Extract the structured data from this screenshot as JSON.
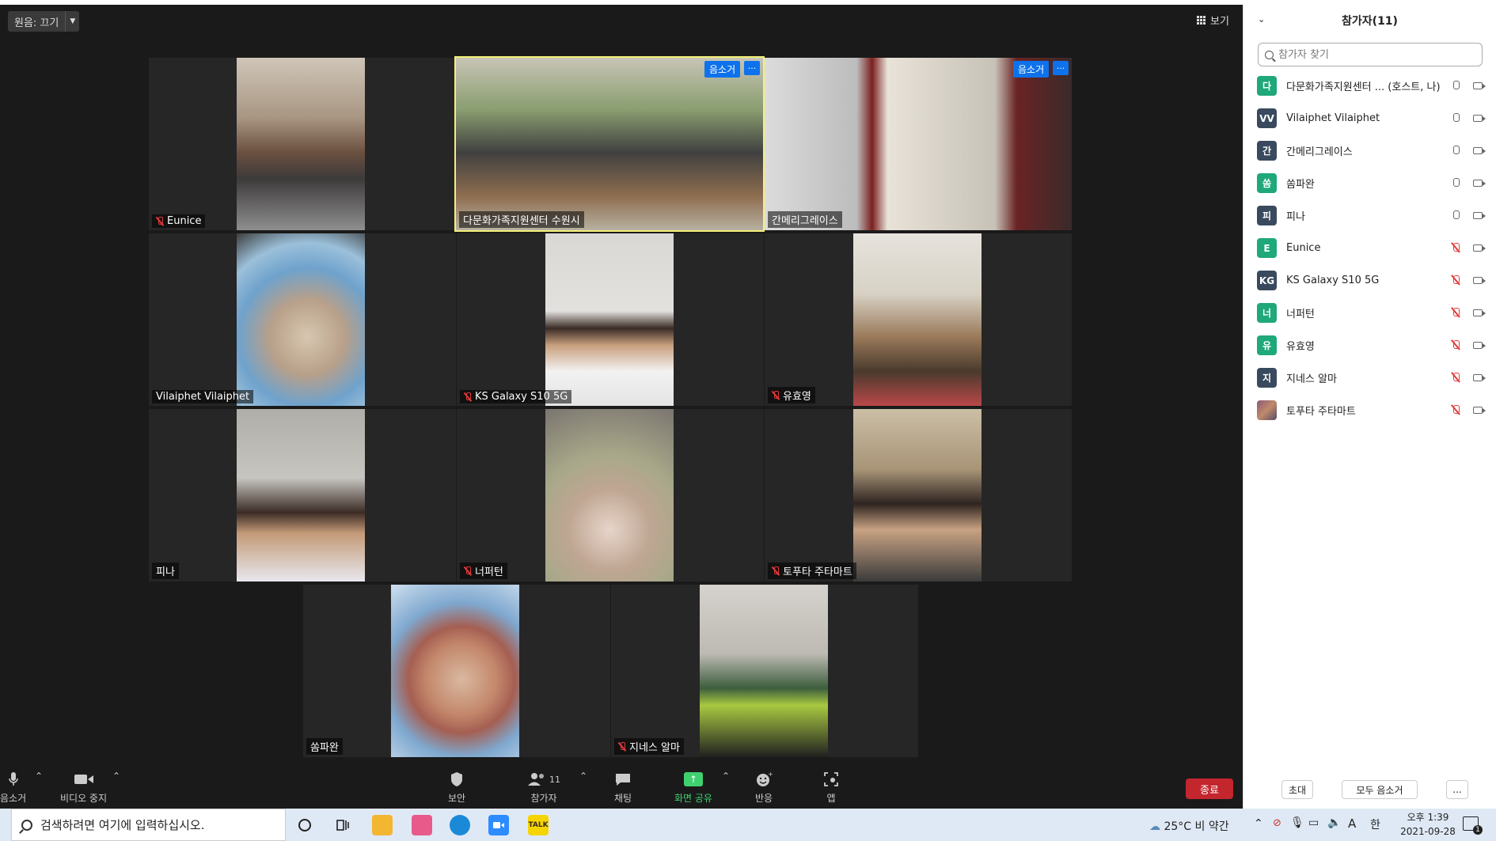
{
  "meeting": {
    "audio_label": "원음: 끄기",
    "view_label": "보기",
    "tiles": [
      {
        "name": "Eunice",
        "muted": true
      },
      {
        "name": "다문화가족지원센터 수원시",
        "muted": false,
        "active": true,
        "chip": "음소거",
        "more": "···"
      },
      {
        "name": "간메리그레이스",
        "muted": false,
        "chip": "음소거",
        "more": "···"
      },
      {
        "name": "Vilaiphet Vilaiphet",
        "muted": false
      },
      {
        "name": "KS Galaxy S10 5G",
        "muted": true
      },
      {
        "name": "유효영",
        "muted": true
      },
      {
        "name": "피나",
        "muted": false
      },
      {
        "name": "너퍼턴",
        "muted": true
      },
      {
        "name": "토푸타 주타마트",
        "muted": true
      },
      {
        "name": "쏨파완",
        "muted": false
      },
      {
        "name": "지네스 알마",
        "muted": true
      }
    ]
  },
  "toolbar": {
    "mute": "음소거",
    "video": "비디오 중지",
    "security": "보안",
    "participants": "참가자",
    "participants_count": "11",
    "chat": "채팅",
    "share": "화면 공유",
    "reactions": "반응",
    "apps": "앱",
    "end": "종료"
  },
  "panel": {
    "title": "참가자(11)",
    "search_placeholder": "참가자 찾기",
    "participants": [
      {
        "initial": "다",
        "name": "다문화가족지원센터 ... (호스트, 나)",
        "color": "#1fa87a",
        "mic": "on"
      },
      {
        "initial": "VV",
        "name": "Vilaiphet Vilaiphet",
        "color": "#3a4a5e",
        "mic": "on"
      },
      {
        "initial": "간",
        "name": "간메리그레이스",
        "color": "#3a4a5e",
        "mic": "on"
      },
      {
        "initial": "쏨",
        "name": "쏨파완",
        "color": "#1fa87a",
        "mic": "on"
      },
      {
        "initial": "피",
        "name": "피나",
        "color": "#3a4a5e",
        "mic": "on"
      },
      {
        "initial": "E",
        "name": "Eunice",
        "color": "#1fa87a",
        "mic": "off"
      },
      {
        "initial": "KG",
        "name": "KS Galaxy S10 5G",
        "color": "#3a4a5e",
        "mic": "off"
      },
      {
        "initial": "너",
        "name": "너퍼턴",
        "color": "#1fa87a",
        "mic": "off"
      },
      {
        "initial": "유",
        "name": "유효영",
        "color": "#1fa87a",
        "mic": "off"
      },
      {
        "initial": "지",
        "name": "지네스 알마",
        "color": "#3a4a5e",
        "mic": "off"
      },
      {
        "initial": "",
        "name": "토푸타 주타마트",
        "color": "#8a5a7a",
        "mic": "off"
      }
    ],
    "invite": "초대",
    "mute_all": "모두 음소거",
    "more": "..."
  },
  "taskbar": {
    "search_placeholder": "검색하려면 여기에 입력하십시오.",
    "weather": "25°C  비 약간",
    "ime": "A",
    "lang": "한",
    "time": "오후 1:39",
    "date": "2021-09-28",
    "notif_count": "1"
  }
}
